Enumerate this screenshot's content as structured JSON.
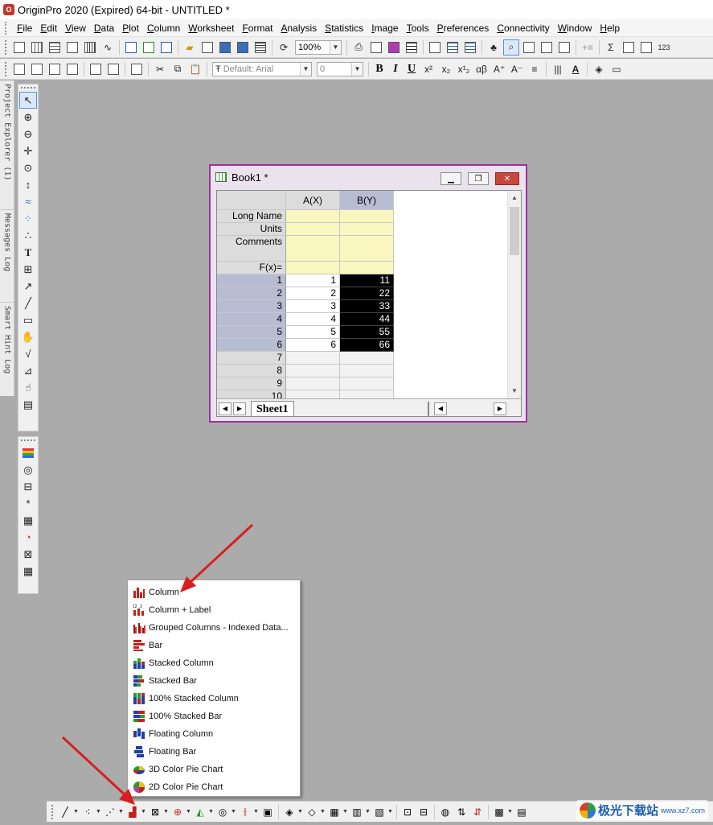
{
  "window": {
    "title": "OriginPro 2020 (Expired) 64-bit - UNTITLED *"
  },
  "menu": [
    "File",
    "Edit",
    "View",
    "Data",
    "Plot",
    "Column",
    "Worksheet",
    "Format",
    "Analysis",
    "Statistics",
    "Image",
    "Tools",
    "Preferences",
    "Connectivity",
    "Window",
    "Help"
  ],
  "toolbar": {
    "zoom": "100%",
    "font": "Default: Arial",
    "font_size": "0",
    "bold": "B",
    "italic": "I",
    "underline": "U"
  },
  "side_tabs": [
    "Project Explorer (1)",
    "Messages Log",
    "Smart Hint Log"
  ],
  "book": {
    "title": "Book1 *",
    "col_headers": [
      "A(X)",
      "B(Y)"
    ],
    "meta_rows": [
      "Long Name",
      "Units",
      "Comments",
      "F(x)="
    ],
    "rows": [
      {
        "n": "1",
        "a": "1",
        "b": "11"
      },
      {
        "n": "2",
        "a": "2",
        "b": "22"
      },
      {
        "n": "3",
        "a": "3",
        "b": "33"
      },
      {
        "n": "4",
        "a": "4",
        "b": "44"
      },
      {
        "n": "5",
        "a": "5",
        "b": "55"
      },
      {
        "n": "6",
        "a": "6",
        "b": "66"
      },
      {
        "n": "7",
        "a": "",
        "b": ""
      },
      {
        "n": "8",
        "a": "",
        "b": ""
      },
      {
        "n": "9",
        "a": "",
        "b": ""
      },
      {
        "n": "10",
        "a": "",
        "b": ""
      }
    ],
    "sheet_tab": "Sheet1"
  },
  "dropdown": {
    "items": [
      "Column",
      "Column + Label",
      "Grouped Columns - Indexed Data...",
      "Bar",
      "Stacked Column",
      "Stacked Bar",
      "100% Stacked Column",
      "100% Stacked Bar",
      "Floating Column",
      "Floating Bar",
      "3D Color Pie Chart",
      "2D Color Pie Chart"
    ]
  },
  "watermark": {
    "text": "极光下载站",
    "sub": "www.xz7.com"
  }
}
